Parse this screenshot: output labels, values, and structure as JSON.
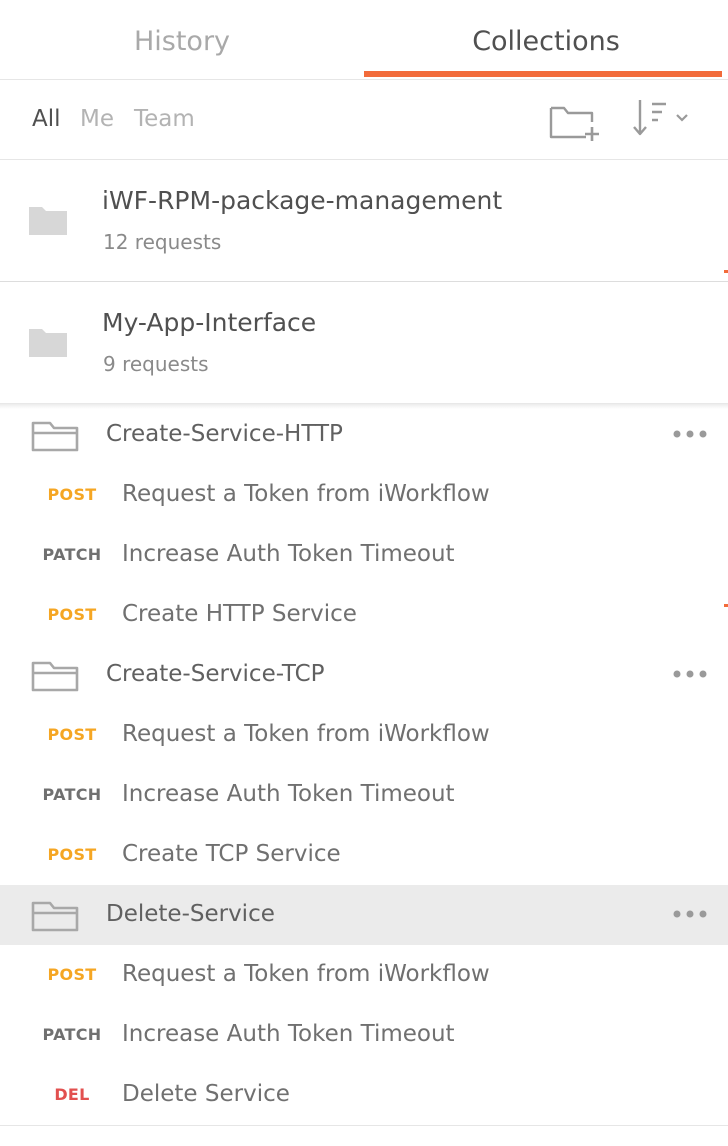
{
  "tabs": {
    "history": "History",
    "collections": "Collections"
  },
  "filters": {
    "all": "All",
    "me": "Me",
    "team": "Team"
  },
  "colors": {
    "accent": "#f26b3a",
    "post": "#f5a623",
    "patch": "#707070",
    "del": "#e2504f"
  },
  "collections": [
    {
      "name": "iWF-RPM-package-management",
      "count": "12 requests"
    },
    {
      "name": "My-App-Interface",
      "count": "9 requests"
    }
  ],
  "folders": [
    {
      "name": "Create-Service-HTTP",
      "requests": [
        {
          "method": "POST",
          "name": "Request a Token from iWorkflow"
        },
        {
          "method": "PATCH",
          "name": "Increase Auth Token Timeout"
        },
        {
          "method": "POST",
          "name": "Create HTTP Service"
        }
      ]
    },
    {
      "name": "Create-Service-TCP",
      "requests": [
        {
          "method": "POST",
          "name": "Request a Token from iWorkflow"
        },
        {
          "method": "PATCH",
          "name": "Increase Auth Token Timeout"
        },
        {
          "method": "POST",
          "name": "Create TCP Service"
        }
      ]
    },
    {
      "name": "Delete-Service",
      "requests": [
        {
          "method": "POST",
          "name": "Request a Token from iWorkflow"
        },
        {
          "method": "PATCH",
          "name": "Increase Auth Token Timeout"
        },
        {
          "method": "DEL",
          "name": "Delete Service"
        }
      ]
    }
  ]
}
